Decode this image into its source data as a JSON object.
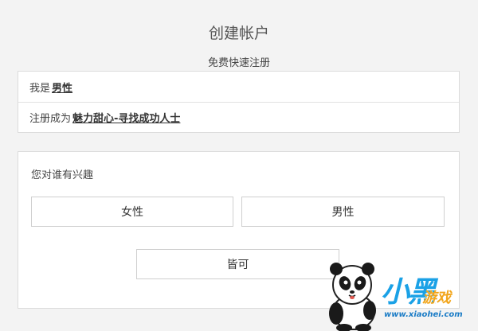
{
  "header": {
    "title": "创建帐户",
    "subtitle": "免费快速注册"
  },
  "identity": {
    "i_am_label": "我是",
    "i_am_value": "男性",
    "register_as_label": "注册成为",
    "register_as_value": "魅力甜心-寻找成功人士"
  },
  "interest": {
    "question": "您对谁有兴趣",
    "options": {
      "female": "女性",
      "male": "男性",
      "both": "皆可"
    }
  },
  "watermark": {
    "brand_text": "小黑",
    "game_text": "游戏",
    "url": "www.xiaohei.com",
    "colors": {
      "blue": "#1aa1e6",
      "orange": "#f2a51a"
    }
  }
}
